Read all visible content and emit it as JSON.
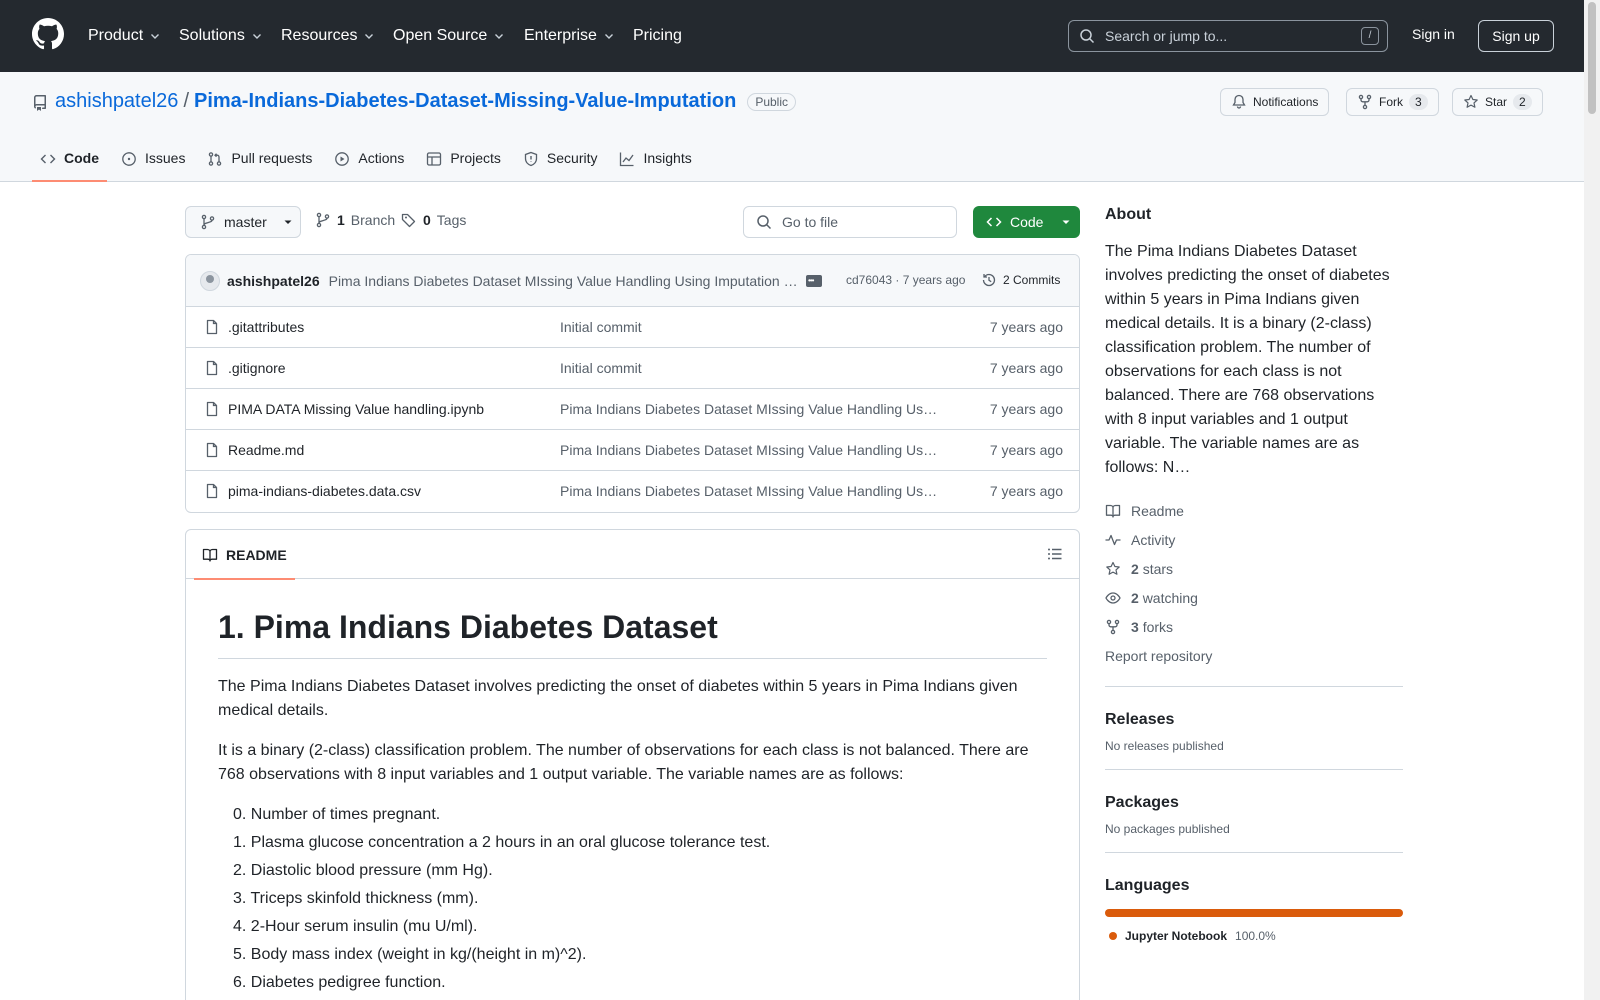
{
  "header": {
    "nav": [
      "Product",
      "Solutions",
      "Resources",
      "Open Source",
      "Enterprise",
      "Pricing"
    ],
    "search_placeholder": "Search or jump to...",
    "search_shortcut": "/",
    "sign_in": "Sign in",
    "sign_up": "Sign up"
  },
  "repo": {
    "owner": "ashishpatel26",
    "separator": "/",
    "name": "Pima-Indians-Diabetes-Dataset-Missing-Value-Imputation",
    "visibility": "Public",
    "notifications_label": "Notifications",
    "fork_label": "Fork",
    "fork_count": "3",
    "star_label": "Star",
    "star_count": "2"
  },
  "tabs": [
    "Code",
    "Issues",
    "Pull requests",
    "Actions",
    "Projects",
    "Security",
    "Insights"
  ],
  "toolbar": {
    "branch": "master",
    "branch_count": "1",
    "branch_label": "Branch",
    "tag_count": "0",
    "tag_label": "Tags",
    "go_to_file": "Go to file",
    "code_label": "Code"
  },
  "commit": {
    "author": "ashishpatel26",
    "message": "Pima Indians Diabetes Dataset MIssing Value Handling Using Imputation Methods",
    "hash_time": "cd76043 · 7 years ago",
    "commits_label": "2 Commits"
  },
  "files": [
    {
      "name": ".gitattributes",
      "message": "Initial commit",
      "date": "7 years ago"
    },
    {
      "name": ".gitignore",
      "message": "Initial commit",
      "date": "7 years ago"
    },
    {
      "name": "PIMA DATA Missing Value handling.ipynb",
      "message": "Pima Indians Diabetes Dataset MIssing Value Handling Using Imputation Methods",
      "date": "7 years ago"
    },
    {
      "name": "Readme.md",
      "message": "Pima Indians Diabetes Dataset MIssing Value Handling Using Imputation Methods",
      "date": "7 years ago"
    },
    {
      "name": "pima-indians-diabetes.data.csv",
      "message": "Pima Indians Diabetes Dataset MIssing Value Handling Using Imputation Methods",
      "date": "7 years ago"
    }
  ],
  "readme": {
    "tab_label": "README",
    "heading": "1. Pima Indians Diabetes Dataset",
    "para1": "The Pima Indians Diabetes Dataset involves predicting the onset of diabetes within 5 years in Pima Indians given medical details.",
    "para2": "It is a binary (2-class) classification problem. The number of observations for each class is not balanced. There are 768 observations with 8 input variables and 1 output variable. The variable names are as follows:",
    "list": [
      "0. Number of times pregnant.",
      "1. Plasma glucose concentration a 2 hours in an oral glucose tolerance test.",
      "2. Diastolic blood pressure (mm Hg).",
      "3. Triceps skinfold thickness (mm).",
      "4. 2-Hour serum insulin (mu U/ml).",
      "5. Body mass index (weight in kg/(height in m)^2).",
      "6. Diabetes pedigree function."
    ]
  },
  "sidebar": {
    "about_title": "About",
    "about_text": "The Pima Indians Diabetes Dataset involves predicting the onset of diabetes within 5 years in Pima Indians given medical details. It is a binary (2-class) classification problem. The number of observations for each class is not balanced. There are 768 observations with 8 input variables and 1 output variable. The variable names are as follows: N…",
    "readme_link": "Readme",
    "activity_link": "Activity",
    "stars_count": "2",
    "stars_label": "stars",
    "watching_count": "2",
    "watching_label": "watching",
    "forks_count": "3",
    "forks_label": "forks",
    "report": "Report repository",
    "releases_title": "Releases",
    "releases_none": "No releases published",
    "packages_title": "Packages",
    "packages_none": "No packages published",
    "languages_title": "Languages",
    "languages": [
      {
        "name": "Jupyter Notebook",
        "percent": "100.0%",
        "color": "#DA5B0B"
      }
    ]
  },
  "colors": {
    "header_bg": "#24292f",
    "link": "#0969da",
    "code_button": "#1f883d",
    "tab_underline": "#fd8c73"
  }
}
